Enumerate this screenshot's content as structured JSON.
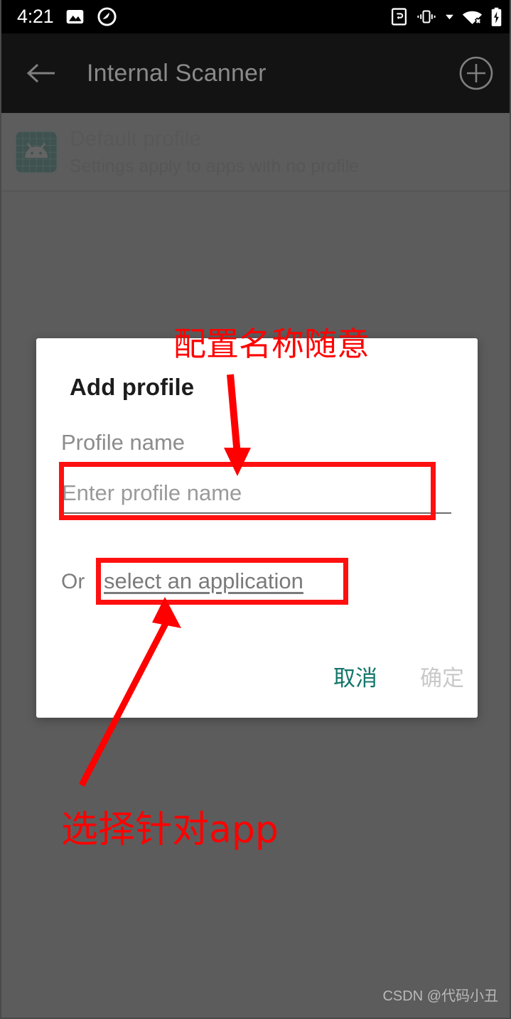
{
  "status_bar": {
    "time": "4:21",
    "left_icons": [
      "photo-icon",
      "do-not-disturb-icon"
    ],
    "right_icons": [
      "screen-rotation-icon",
      "vibrate-icon",
      "dropdown-caret-icon",
      "wifi-off-icon",
      "battery-charging-icon"
    ]
  },
  "app_bar": {
    "back_icon": "back-arrow-icon",
    "title": "Internal Scanner",
    "add_icon": "plus-circle-icon"
  },
  "profile_list": {
    "items": [
      {
        "icon": "android-robot-icon",
        "title": "Default profile",
        "subtitle": "Settings apply to apps with no profile"
      }
    ]
  },
  "dialog": {
    "title": "Add profile",
    "field_label": "Profile name",
    "field_value": "",
    "field_placeholder": "Enter profile name",
    "or_text": "Or",
    "select_application_link": "select an application",
    "cancel_label": "取消",
    "confirm_label": "确定"
  },
  "annotations": {
    "top_text": "配置名称随意",
    "bottom_text": "选择针对app",
    "color": "#ff0000"
  },
  "watermark": "CSDN @代码小丑",
  "colors": {
    "status_bar_bg": "#000000",
    "app_bar_bg": "#131313",
    "scrim": "#666666",
    "dialog_bg": "#ffffff",
    "accent_teal": "#13766b",
    "disabled_gray": "#c9c9c9",
    "annotation_red": "#ff0000",
    "icon_teal": "#1b4e49"
  }
}
